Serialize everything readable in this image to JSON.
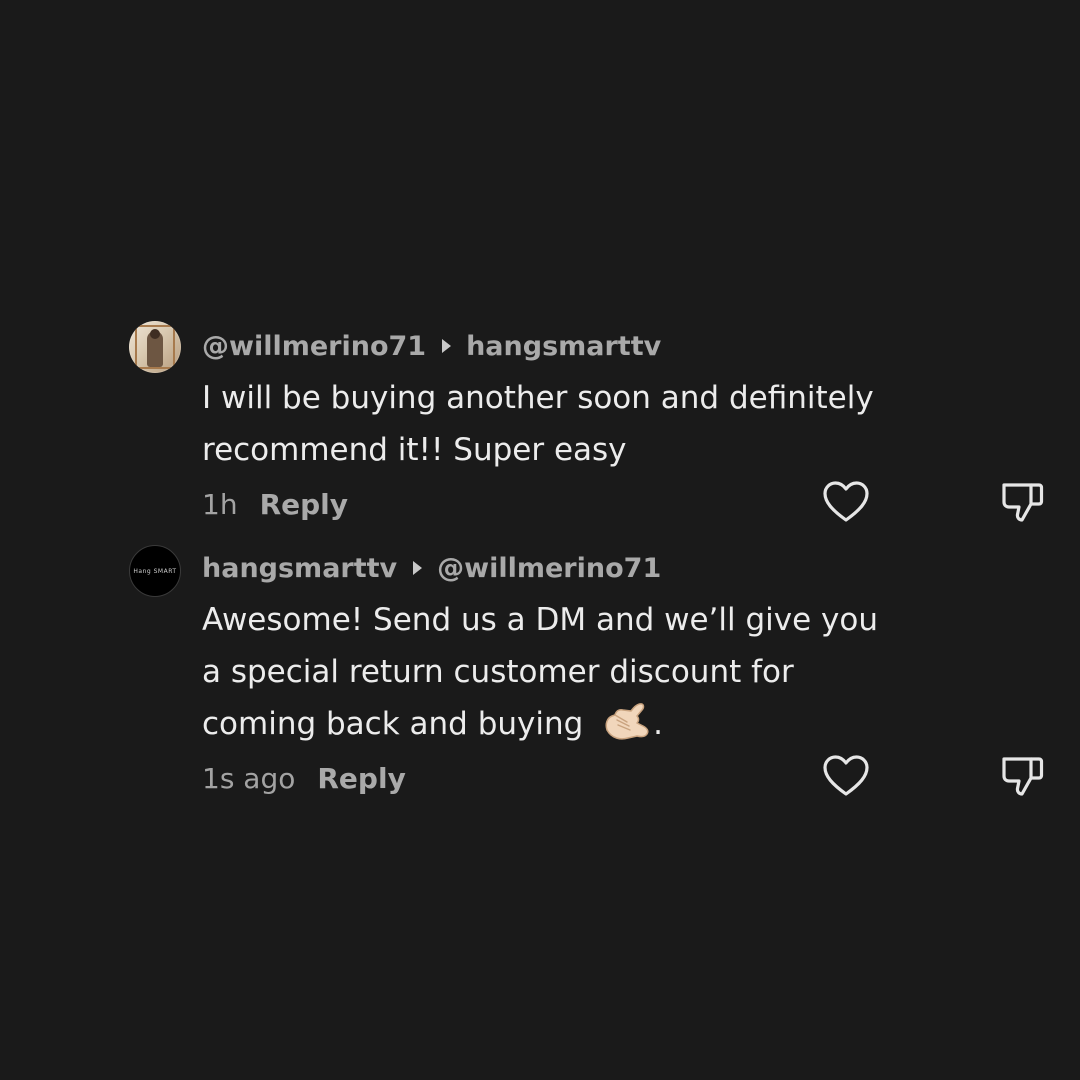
{
  "comments": [
    {
      "author": "@willmerino71",
      "reply_to": "hangsmarttv",
      "lines": [
        "I will be buying another soon and definitely",
        "recommend it!! Super easy"
      ],
      "time": "1h",
      "reply_label": "Reply",
      "avatar_icon": "profile-photo"
    },
    {
      "author": "hangsmarttv",
      "reply_to": "@willmerino71",
      "lines": [
        "Awesome! Send us a DM and we’ll give you",
        "a special return customer discount for",
        "coming back and buying"
      ],
      "line_suffix": ".",
      "emoji_icon": "call-me-hand-emoji",
      "time": "1s ago",
      "reply_label": "Reply",
      "avatar_text": "Hang SMART",
      "avatar_icon": "brand-logo"
    }
  ],
  "icons": {
    "like": "heart-outline-icon",
    "dislike": "thumbs-down-outline-icon"
  },
  "colors": {
    "background": "#1a1a1a",
    "username": "#a9a9a9",
    "body": "#ececec",
    "muted": "#a3a3a3"
  }
}
